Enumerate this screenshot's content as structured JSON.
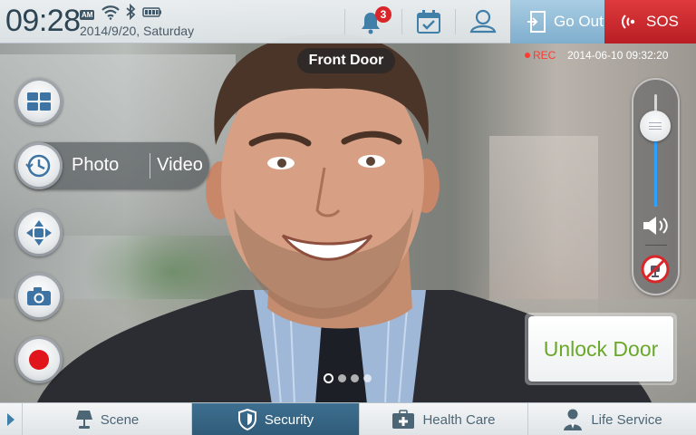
{
  "status": {
    "time": "09:28",
    "ampm": "AM",
    "date": "2014/9/20, Saturday",
    "notification_count": "3",
    "go_out_label": "Go Out",
    "sos_label": "SOS"
  },
  "camera": {
    "name": "Front Door",
    "rec_label": "REC",
    "timestamp": "2014-06-10  09:32:20"
  },
  "controls": {
    "photo_label": "Photo",
    "video_label": "Video",
    "unlock_label": "Unlock Door",
    "volume_level": 0.72,
    "page_count": 4,
    "active_page": 1
  },
  "nav": {
    "items": [
      {
        "label": "Scene",
        "icon": "lamp-icon"
      },
      {
        "label": "Security",
        "icon": "shield-icon"
      },
      {
        "label": "Health Care",
        "icon": "medical-kit-icon"
      },
      {
        "label": "Life Service",
        "icon": "person-service-icon"
      }
    ],
    "active": 1
  },
  "colors": {
    "accent": "#2f5b78",
    "sos": "#c8232a",
    "unlock_text": "#6aa82a",
    "slider_fill": "#2ea1ff"
  }
}
